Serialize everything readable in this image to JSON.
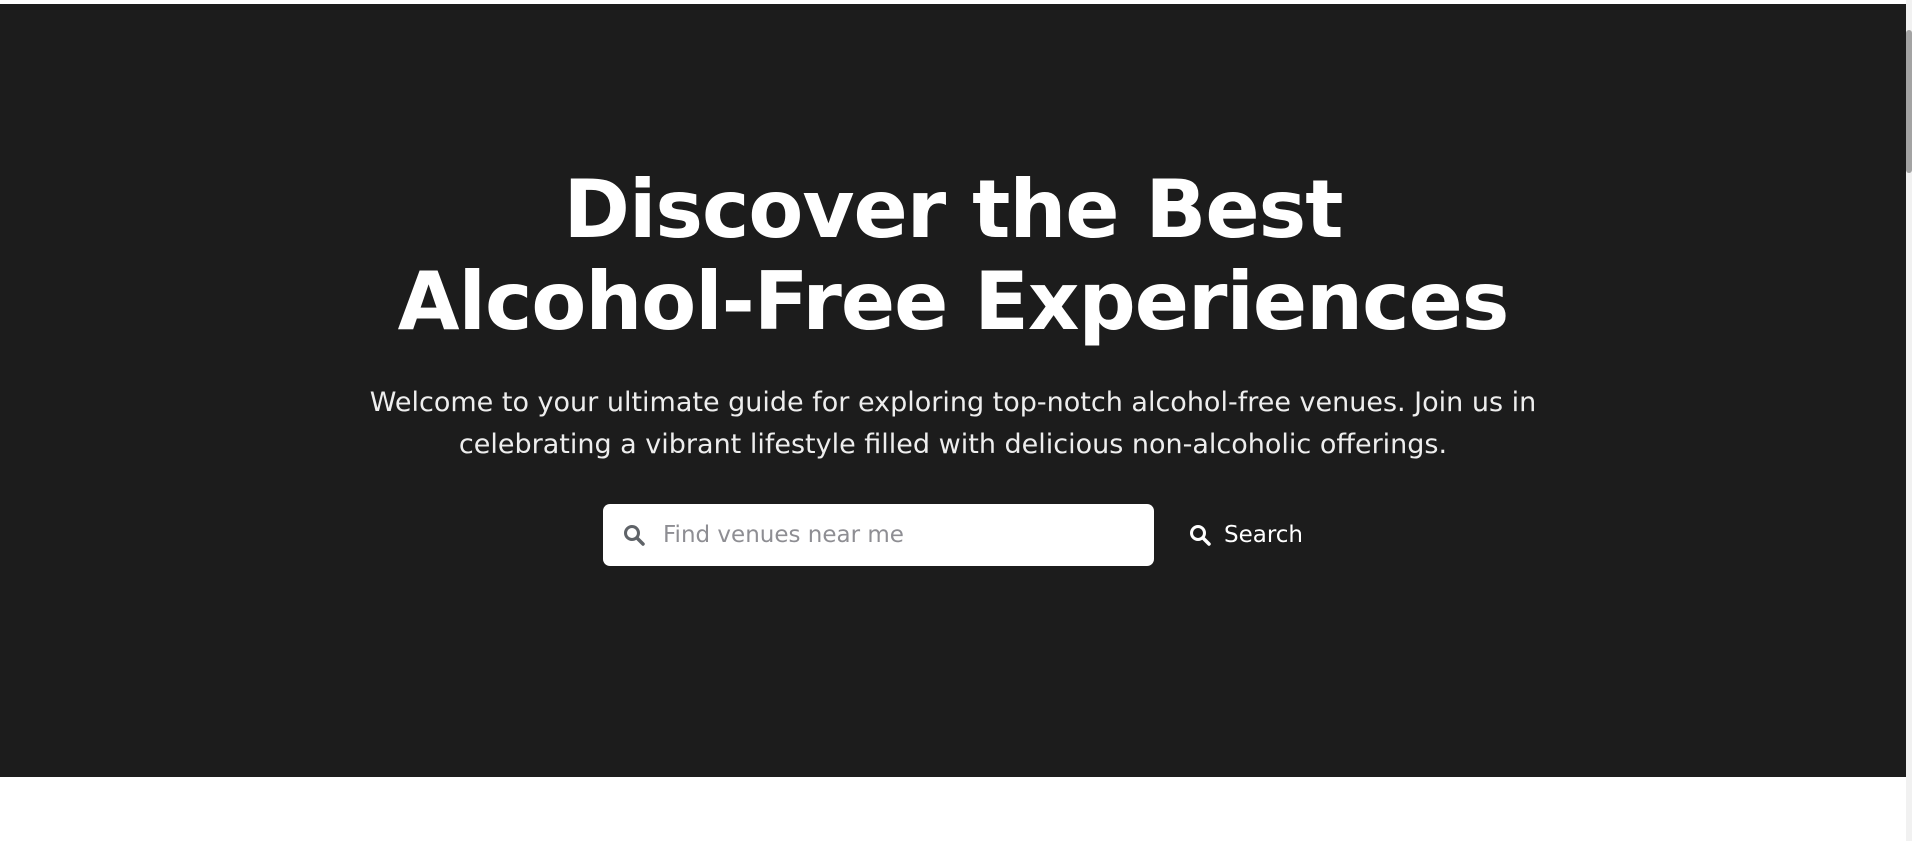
{
  "hero": {
    "title": "Discover the Best Alcohol-Free Experiences",
    "subtitle": "Welcome to your ultimate guide for exploring top-notch alcohol-free venues. Join us in celebrating a vibrant lifestyle filled with delicious non-alcoholic offerings.",
    "background_color": "#1c1c1c"
  },
  "search": {
    "placeholder": "Find venues near me",
    "value": "",
    "input_icon": "search-icon",
    "button_label": "Search",
    "button_icon": "search-icon"
  }
}
